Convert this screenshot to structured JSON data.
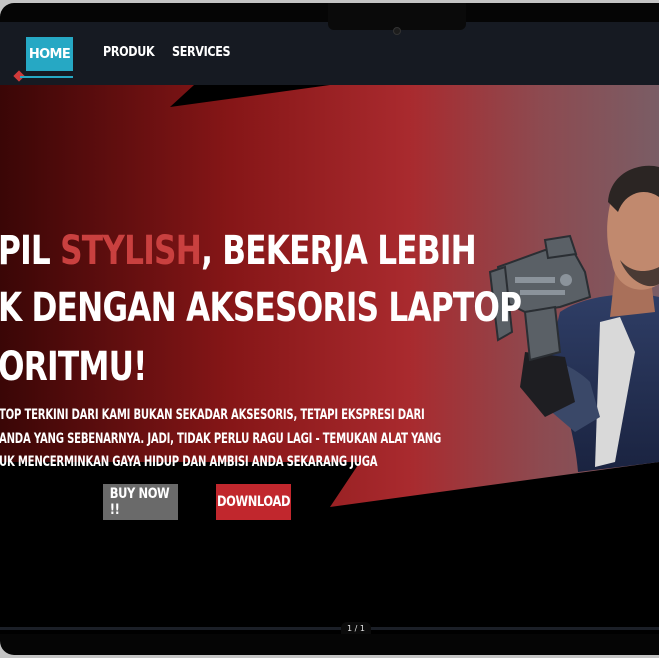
{
  "nav": {
    "items": [
      "HOME",
      "PRODUK",
      "SERVICES"
    ]
  },
  "hero": {
    "headline": {
      "line1_prefix": "PIL ",
      "line1_accent": "STYLISH",
      "line1_suffix": ", BEKERJA LEBIH",
      "line2": "K DENGAN AKSESORIS LAPTOP",
      "line3": "ORITMU!"
    },
    "body": [
      "TOP TERKINI DARI KAMI BUKAN SEKADAR AKSESORIS, TETAPI EKSPRESI DARI",
      "ANDA YANG SEBENARNYA. JADI, TIDAK PERLU RAGU LAGI - TEMUKAN ALAT YANG",
      "UK MENCERMINKAN GAYA HIDUP DAN AMBISI ANDA SEKARANG JUGA"
    ],
    "buttons": {
      "buy": "BUY NOW !!",
      "download": "DOWNLOAD"
    }
  },
  "pager": "1 / 1",
  "colors": {
    "accent_cyan": "#26a8c4",
    "accent_red": "#c1272d",
    "navbar": "#161a22"
  }
}
